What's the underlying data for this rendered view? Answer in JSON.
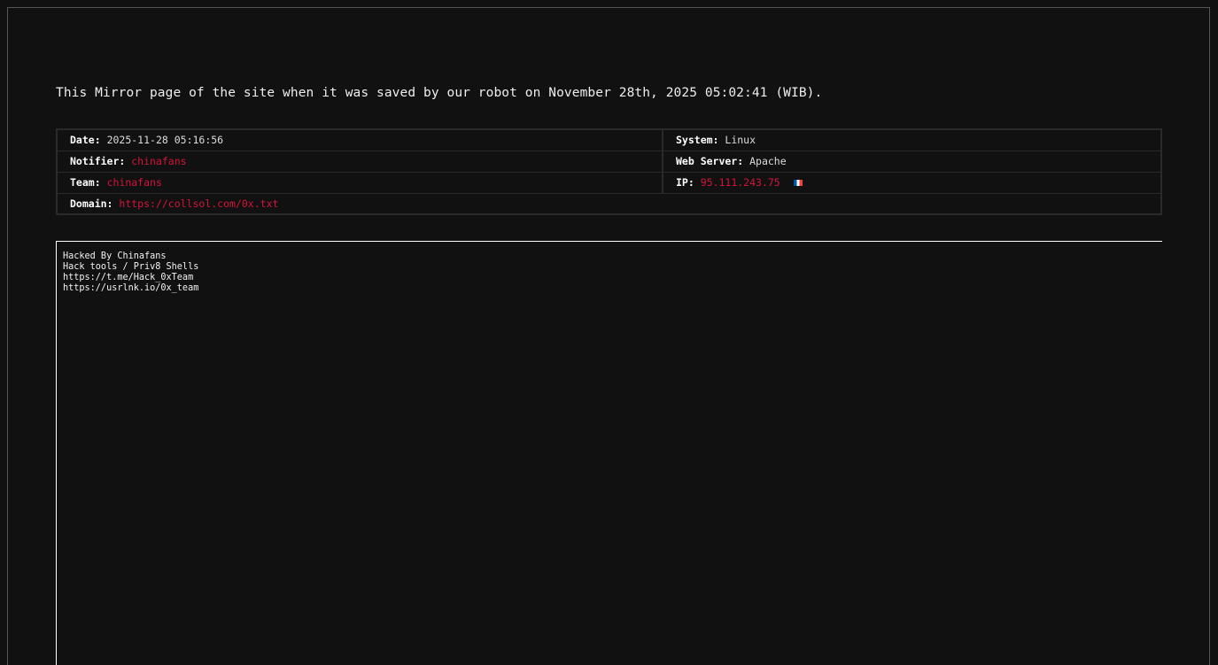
{
  "intro": "This Mirror page of the site when it was saved by our robot on November 28th, 2025 05:02:41 (WIB).",
  "info": {
    "date_label": "Date:",
    "date_value": "2025-11-28 05:16:56",
    "system_label": "System:",
    "system_value": "Linux",
    "notifier_label": "Notifier:",
    "notifier_value": "chinafans",
    "webserver_label": "Web Server:",
    "webserver_value": "Apache",
    "team_label": "Team:",
    "team_value": "chinafans",
    "ip_label": "IP:",
    "ip_value": "95.111.243.75",
    "ip_flag_icon": "france-flag-icon",
    "domain_label": "Domain:",
    "domain_value": "https://collsol.com/0x.txt"
  },
  "mirror": {
    "lines": [
      "Hacked By Chinafans",
      "Hack tools / Priv8 Shells",
      "https://t.me/Hack_0xTeam",
      "https://usrlnk.io/0x_team"
    ]
  },
  "colors": {
    "background": "#111111",
    "link": "#d4143c",
    "border": "#2a2a2a"
  }
}
